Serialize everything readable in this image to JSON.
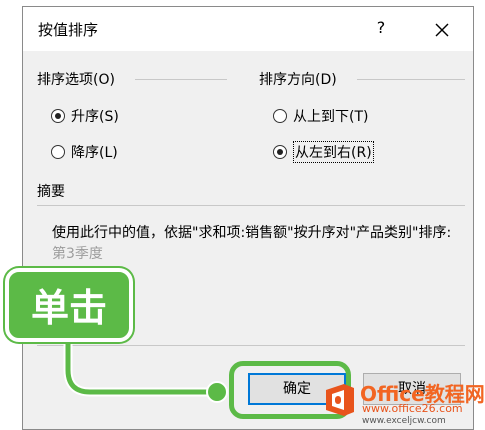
{
  "dialog": {
    "title": "按值排序",
    "help_label": "?",
    "close_icon": "close-icon"
  },
  "sort_options": {
    "title": "排序选项(O)",
    "items": [
      {
        "label": "升序(S)",
        "checked": true
      },
      {
        "label": "降序(L)",
        "checked": false
      }
    ]
  },
  "sort_direction": {
    "title": "排序方向(D)",
    "items": [
      {
        "label": "从上到下(T)",
        "checked": false
      },
      {
        "label": "从左到右(R)",
        "checked": true
      }
    ]
  },
  "summary": {
    "title": "摘要",
    "text": "使用此行中的值，依据\"求和项:销售额\"按升序对\"产品类别\"排序:",
    "text_obscured": "第3季度"
  },
  "buttons": {
    "ok_label": "确定",
    "cancel_label": "取消"
  },
  "callout": {
    "label": "单击",
    "color": "#5cba47"
  },
  "watermark": {
    "title": "Office教程网",
    "url": "www.office26.com",
    "url2": "www.exceljcw.com",
    "color": "#f26522"
  }
}
